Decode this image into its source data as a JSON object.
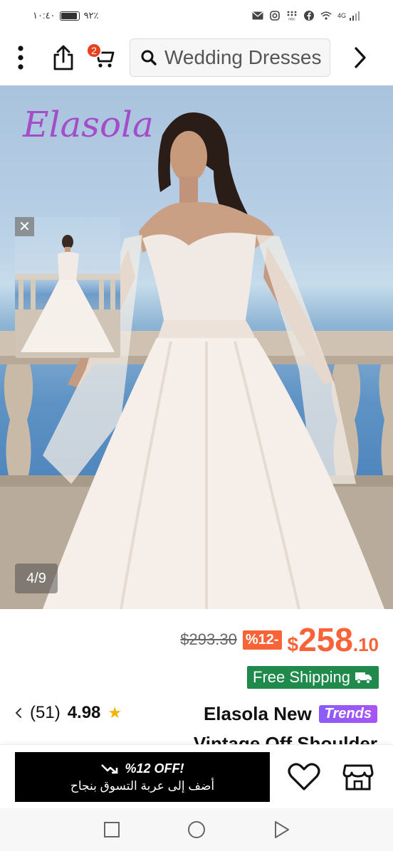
{
  "status_bar": {
    "time": "١٠:٤٠",
    "battery": "٩٢٪",
    "network": "4G",
    "icons": [
      "mail-icon",
      "instagram-icon",
      "mbc-icon",
      "facebook-icon",
      "wifi-icon",
      "signal-icon"
    ]
  },
  "nav": {
    "cart_count": "2",
    "search_text": "Wedding Dresses",
    "icons": [
      "more-vertical-icon",
      "share-icon",
      "cart-icon",
      "search-icon",
      "chevron-right-icon"
    ]
  },
  "gallery": {
    "brand_logo": "Elasola",
    "counter": "4/9",
    "close_label": "✕"
  },
  "price": {
    "original": "$293.30",
    "discount": "%12-",
    "currency": "$",
    "sale_int": "258",
    "sale_dec": ".10"
  },
  "shipping": {
    "label": "Free Shipping"
  },
  "product": {
    "rating": "4.98",
    "reviews": "(51)",
    "title_line1": "Elasola New",
    "badge": "Trends",
    "title_line2": "Vintage Off Shoulder"
  },
  "actions": {
    "discount_label": "%12 OFF!",
    "add_to_cart": "أضف إلى عربة التسوق بنجاح"
  },
  "colors": {
    "accent": "#fa6338",
    "shipping_green": "#1f8a4c",
    "brand_purple": "#a34ec8",
    "trends_purple": "#8b5cf6"
  }
}
